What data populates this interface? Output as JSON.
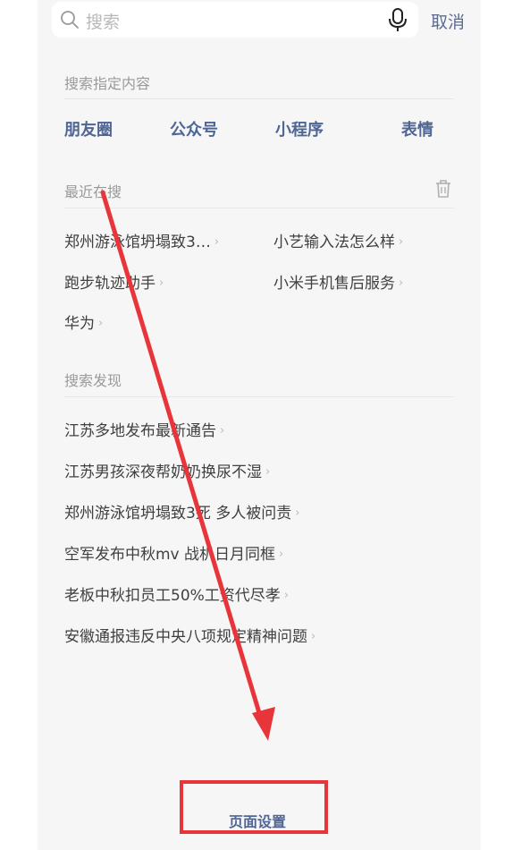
{
  "search": {
    "placeholder": "搜索",
    "cancel": "取消"
  },
  "specify": {
    "title": "搜索指定内容",
    "categories": [
      "朋友圈",
      "公众号",
      "小程序",
      "表情"
    ]
  },
  "recent": {
    "title": "最近在搜",
    "items": [
      "郑州游泳馆坍塌致3…",
      "小艺输入法怎么样",
      "跑步轨迹助手",
      "小米手机售后服务",
      "华为"
    ]
  },
  "discover": {
    "title": "搜索发现",
    "items": [
      "江苏多地发布最新通告",
      "江苏男孩深夜帮奶奶换尿不湿",
      "郑州游泳馆坍塌致3死 多人被问责",
      "空军发布中秋mv 战机日月同框",
      "老板中秋扣员工50%工资代尽孝",
      "安徽通报违反中央八项规定精神问题"
    ]
  },
  "bottom": {
    "label": "页面设置"
  },
  "colors": {
    "accent": "#4f6694",
    "annotation": "#e8353a"
  },
  "icons": {
    "search": "search-icon",
    "mic": "mic-icon",
    "trash": "trash-icon",
    "chevron": "chevron-right-icon"
  }
}
